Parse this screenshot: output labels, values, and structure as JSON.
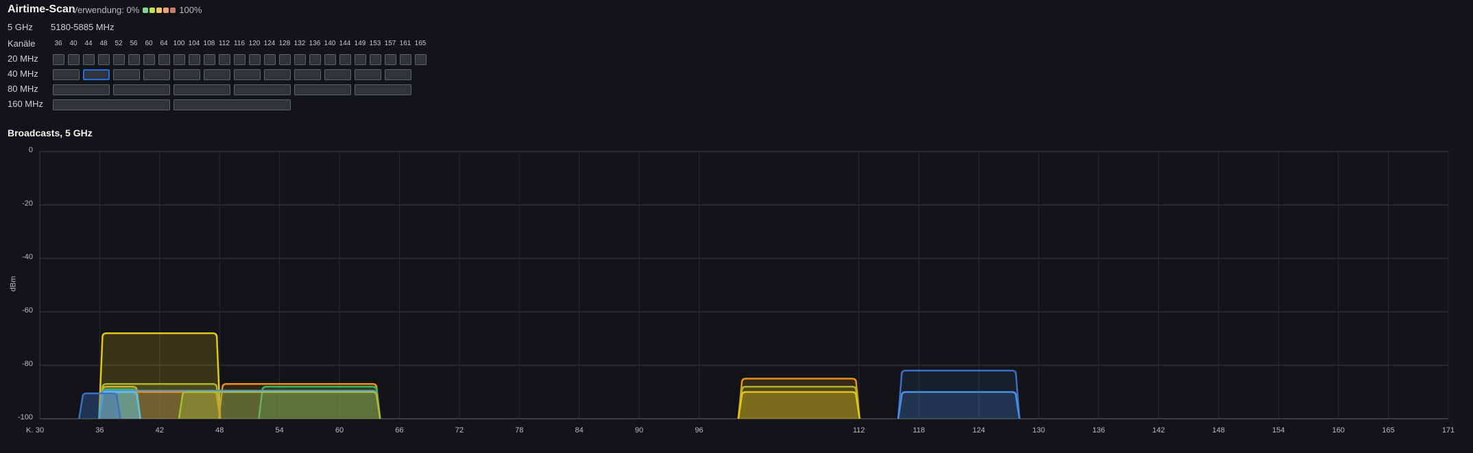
{
  "header": {
    "title": "Airtime-Scan",
    "usage_label": "Verwendung: 0%",
    "usage_max": "100%",
    "usage_colors": [
      "#7fd88f",
      "#c5dd4a",
      "#f5c76a",
      "#f0a07a",
      "#c47e6a"
    ]
  },
  "band": {
    "label": "5 GHz",
    "range": "5180-5885 MHz"
  },
  "channels_label": "Kanäle",
  "channels": [
    "36",
    "40",
    "44",
    "48",
    "52",
    "56",
    "60",
    "64",
    "100",
    "104",
    "108",
    "112",
    "116",
    "120",
    "124",
    "128",
    "132",
    "136",
    "140",
    "144",
    "149",
    "153",
    "157",
    "161",
    "165"
  ],
  "widths": [
    {
      "label": "20 MHz",
      "span": 1,
      "count": 25,
      "selected": -1
    },
    {
      "label": "40 MHz",
      "span": 2,
      "count": 12,
      "selected": 1
    },
    {
      "label": "80 MHz",
      "span": 4,
      "count": 6,
      "selected": -1
    },
    {
      "label": "160 MHz",
      "span": 8,
      "count": 2,
      "selected": -1
    }
  ],
  "broadcasts_title": "Broadcasts,  5 GHz",
  "chart_data": {
    "type": "area",
    "ylabel": "dBm",
    "xlabel": "K.",
    "xlim": [
      30,
      171
    ],
    "ylim": [
      -100,
      0
    ],
    "xticks": [
      30,
      36,
      42,
      48,
      54,
      60,
      66,
      72,
      78,
      84,
      90,
      96,
      112,
      118,
      124,
      130,
      136,
      142,
      148,
      154,
      160,
      165,
      171
    ],
    "yticks": [
      0,
      -20,
      -40,
      -60,
      -80,
      -100
    ],
    "grid": true,
    "series": [
      {
        "from": 36,
        "to": 48,
        "dbm": -68,
        "color": "#e3c51c",
        "fill": 0.18
      },
      {
        "from": 48,
        "to": 64,
        "dbm": -87,
        "color": "#e8901c",
        "fill": 0.15
      },
      {
        "from": 36,
        "to": 48,
        "dbm": -87,
        "color": "#a8b82a",
        "fill": 0.15
      },
      {
        "from": 36,
        "to": 40,
        "dbm": -88,
        "color": "#c9b33a",
        "fill": 0.15
      },
      {
        "from": 52,
        "to": 64,
        "dbm": -88,
        "color": "#3cb65a",
        "fill": 0.15
      },
      {
        "from": 36,
        "to": 40,
        "dbm": -89,
        "color": "#3cb65a",
        "fill": 0.15
      },
      {
        "from": 36,
        "to": 64,
        "dbm": -89.5,
        "color": "#4a90e2",
        "fill": 0.15
      },
      {
        "from": 36,
        "to": 48,
        "dbm": -90,
        "color": "#e8901c",
        "fill": 0.25
      },
      {
        "from": 44,
        "to": 64,
        "dbm": -90,
        "color": "#a8c030",
        "fill": 0.35
      },
      {
        "from": 36,
        "to": 40,
        "dbm": -90,
        "color": "#5bc0eb",
        "fill": 0.45
      },
      {
        "from": 34,
        "to": 38,
        "dbm": -90.5,
        "color": "#3a6fc4",
        "fill": 0.35
      },
      {
        "from": 100,
        "to": 112,
        "dbm": -85,
        "color": "#e8901c",
        "fill": 0.18
      },
      {
        "from": 100,
        "to": 112,
        "dbm": -88,
        "color": "#a8b82a",
        "fill": 0.2
      },
      {
        "from": 100,
        "to": 112,
        "dbm": -90,
        "color": "#e3c51c",
        "fill": 0.3
      },
      {
        "from": 116,
        "to": 128,
        "dbm": -82,
        "color": "#3a6fc4",
        "fill": 0.12
      },
      {
        "from": 116,
        "to": 128,
        "dbm": -90,
        "color": "#4a90e2",
        "fill": 0.2
      }
    ]
  }
}
